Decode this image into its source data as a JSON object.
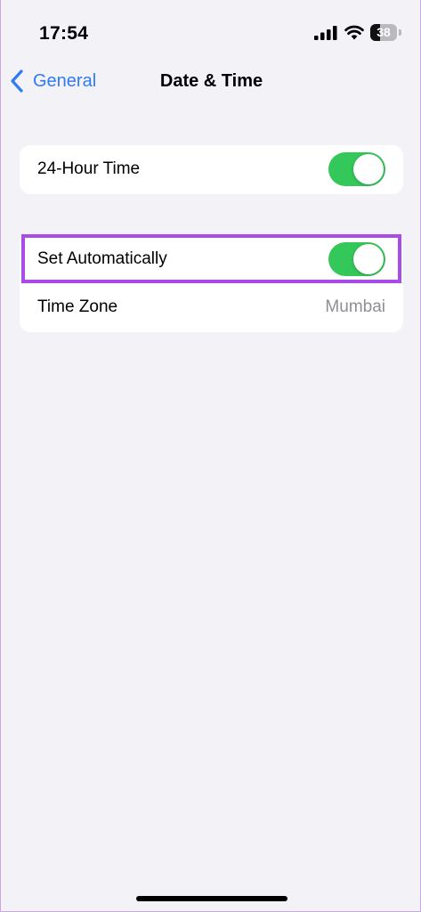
{
  "status_bar": {
    "time": "17:54",
    "battery_level": "38",
    "battery_fraction": 0.38,
    "icons": [
      "cellular-signal-icon",
      "wifi-icon",
      "battery-icon"
    ]
  },
  "nav": {
    "back_label": "General",
    "title": "Date & Time"
  },
  "settings": {
    "hour_24": {
      "label": "24-Hour Time",
      "enabled": true
    },
    "set_automatically": {
      "label": "Set Automatically",
      "enabled": true
    },
    "time_zone": {
      "label": "Time Zone",
      "value": "Mumbai"
    }
  },
  "colors": {
    "accent": "#2f7bf6",
    "toggle_on": "#34c759",
    "highlight": "#a94be6",
    "background": "#f2f2f7"
  }
}
